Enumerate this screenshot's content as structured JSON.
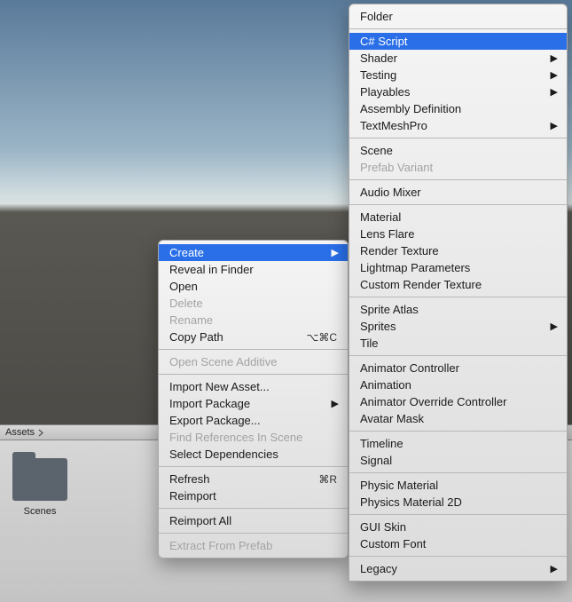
{
  "panel": {
    "breadcrumb": "Assets"
  },
  "folder": {
    "label": "Scenes"
  },
  "primaryMenu": [
    {
      "type": "item",
      "label": "Create",
      "selected": true,
      "submenu": true
    },
    {
      "type": "item",
      "label": "Reveal in Finder"
    },
    {
      "type": "item",
      "label": "Open"
    },
    {
      "type": "item",
      "label": "Delete",
      "disabled": true
    },
    {
      "type": "item",
      "label": "Rename",
      "disabled": true
    },
    {
      "type": "item",
      "label": "Copy Path",
      "shortcut": "⌥⌘C"
    },
    {
      "type": "sep"
    },
    {
      "type": "item",
      "label": "Open Scene Additive",
      "disabled": true
    },
    {
      "type": "sep"
    },
    {
      "type": "item",
      "label": "Import New Asset..."
    },
    {
      "type": "item",
      "label": "Import Package",
      "submenu": true
    },
    {
      "type": "item",
      "label": "Export Package..."
    },
    {
      "type": "item",
      "label": "Find References In Scene",
      "disabled": true
    },
    {
      "type": "item",
      "label": "Select Dependencies"
    },
    {
      "type": "sep"
    },
    {
      "type": "item",
      "label": "Refresh",
      "shortcut": "⌘R"
    },
    {
      "type": "item",
      "label": "Reimport"
    },
    {
      "type": "sep"
    },
    {
      "type": "item",
      "label": "Reimport All"
    },
    {
      "type": "sep"
    },
    {
      "type": "item",
      "label": "Extract From Prefab",
      "disabled": true
    }
  ],
  "secondaryMenu": [
    {
      "type": "item",
      "label": "Folder"
    },
    {
      "type": "sep"
    },
    {
      "type": "item",
      "label": "C# Script",
      "selected": true
    },
    {
      "type": "item",
      "label": "Shader",
      "submenu": true
    },
    {
      "type": "item",
      "label": "Testing",
      "submenu": true
    },
    {
      "type": "item",
      "label": "Playables",
      "submenu": true
    },
    {
      "type": "item",
      "label": "Assembly Definition"
    },
    {
      "type": "item",
      "label": "TextMeshPro",
      "submenu": true
    },
    {
      "type": "sep"
    },
    {
      "type": "item",
      "label": "Scene"
    },
    {
      "type": "item",
      "label": "Prefab Variant",
      "disabled": true
    },
    {
      "type": "sep"
    },
    {
      "type": "item",
      "label": "Audio Mixer"
    },
    {
      "type": "sep"
    },
    {
      "type": "item",
      "label": "Material"
    },
    {
      "type": "item",
      "label": "Lens Flare"
    },
    {
      "type": "item",
      "label": "Render Texture"
    },
    {
      "type": "item",
      "label": "Lightmap Parameters"
    },
    {
      "type": "item",
      "label": "Custom Render Texture"
    },
    {
      "type": "sep"
    },
    {
      "type": "item",
      "label": "Sprite Atlas"
    },
    {
      "type": "item",
      "label": "Sprites",
      "submenu": true
    },
    {
      "type": "item",
      "label": "Tile"
    },
    {
      "type": "sep"
    },
    {
      "type": "item",
      "label": "Animator Controller"
    },
    {
      "type": "item",
      "label": "Animation"
    },
    {
      "type": "item",
      "label": "Animator Override Controller"
    },
    {
      "type": "item",
      "label": "Avatar Mask"
    },
    {
      "type": "sep"
    },
    {
      "type": "item",
      "label": "Timeline"
    },
    {
      "type": "item",
      "label": "Signal"
    },
    {
      "type": "sep"
    },
    {
      "type": "item",
      "label": "Physic Material"
    },
    {
      "type": "item",
      "label": "Physics Material 2D"
    },
    {
      "type": "sep"
    },
    {
      "type": "item",
      "label": "GUI Skin"
    },
    {
      "type": "item",
      "label": "Custom Font"
    },
    {
      "type": "sep"
    },
    {
      "type": "item",
      "label": "Legacy",
      "submenu": true
    }
  ]
}
